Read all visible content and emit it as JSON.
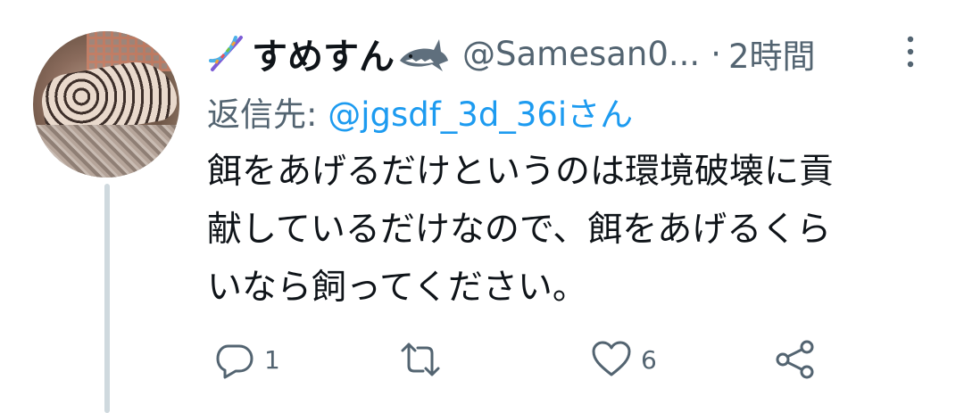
{
  "tweet": {
    "display_name": "すめすん",
    "handle": "@Samesan0...",
    "separator": "·",
    "time": "2時間",
    "reply_label": "返信先: ",
    "reply_mention": "@jgsdf_3d_36iさん",
    "body_lines": [
      "餌をあげるだけというのは環境破壊に貢",
      "献しているだけなので、餌をあげるくら",
      "いなら飼ってください。"
    ],
    "reply_count": "1",
    "retweet_count": "",
    "like_count": "6"
  },
  "colors": {
    "text": "#0f1419",
    "secondary": "#536471",
    "link": "#1d9bf0",
    "thread_line": "#cfd9de"
  },
  "icons": {
    "leading_emoji": "dna-icon",
    "trailing_emoji": "shark-icon",
    "more": "more-vertical-icon",
    "reply": "reply-icon",
    "retweet": "retweet-icon",
    "like": "heart-icon",
    "share": "share-icon"
  }
}
